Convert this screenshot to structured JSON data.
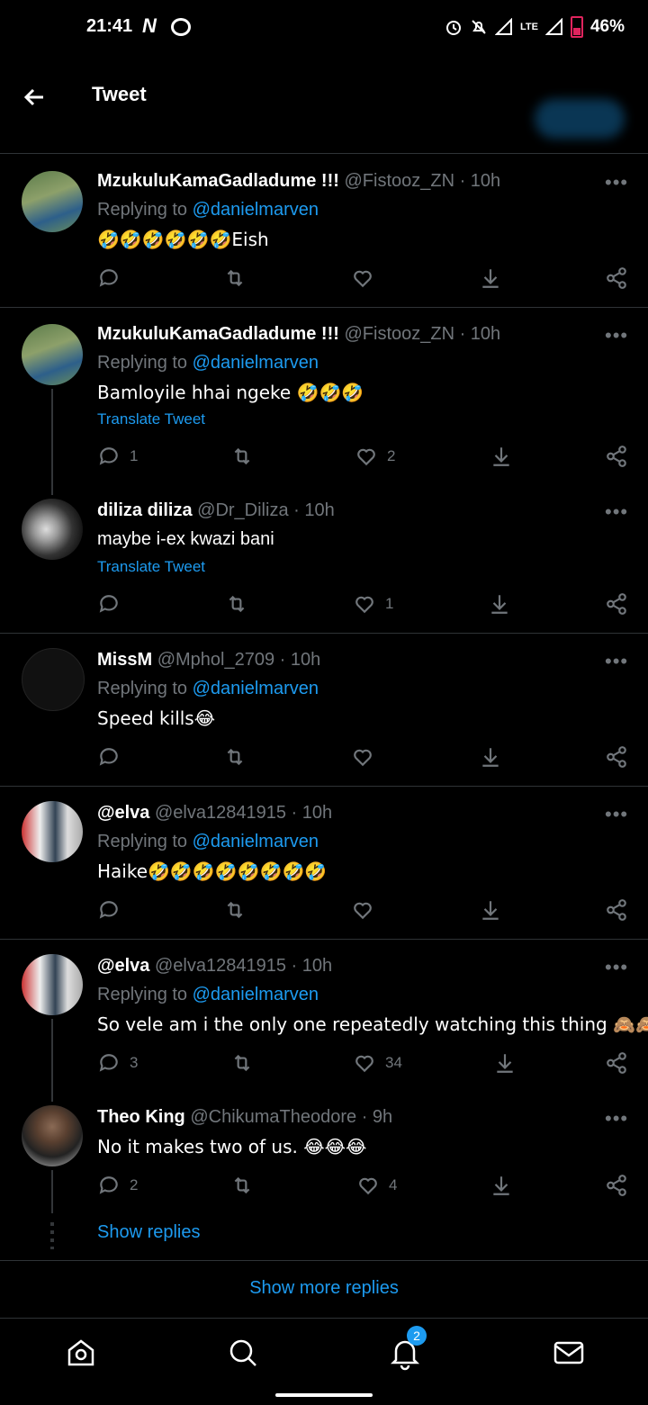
{
  "status_bar": {
    "time": "21:41",
    "n_icon": "N",
    "lte": "LTE",
    "battery": "46%"
  },
  "header": {
    "title": "Tweet"
  },
  "tweets": [
    {
      "name": "MzukuluKamaGadladume !!!",
      "handle": "@Fistooz_ZN · 10h",
      "replying_prefix": "Replying to ",
      "replying_to": "@danielmarven",
      "text": "🤣🤣🤣🤣🤣🤣Eish",
      "replies": "",
      "likes": ""
    },
    {
      "name": "MzukuluKamaGadladume !!!",
      "handle": "@Fistooz_ZN · 10h",
      "replying_prefix": "Replying to ",
      "replying_to": "@danielmarven",
      "text": "Bamloyile hhai ngeke 🤣🤣🤣",
      "translate": "Translate Tweet",
      "replies": "1",
      "likes": "2"
    },
    {
      "name": "diliza diliza",
      "handle": "@Dr_Diliza · 10h",
      "text": "maybe i-ex kwazi bani",
      "translate": "Translate Tweet",
      "replies": "",
      "likes": "1"
    },
    {
      "name": "MissM",
      "handle": "@Mphol_2709 · 10h",
      "replying_prefix": "Replying to ",
      "replying_to": "@danielmarven",
      "text": "Speed kills😂",
      "replies": "",
      "likes": ""
    },
    {
      "name": "@elva",
      "handle": "@elva12841915 · 10h",
      "replying_prefix": "Replying to ",
      "replying_to": "@danielmarven",
      "text": "Haike🤣🤣🤣🤣🤣🤣🤣🤣",
      "replies": "",
      "likes": ""
    },
    {
      "name": "@elva",
      "handle": "@elva12841915 · 10h",
      "replying_prefix": "Replying to ",
      "replying_to": "@danielmarven",
      "text": "So vele am i the only one repeatedly watching this thing 🙈🙈",
      "replies": "3",
      "likes": "34"
    },
    {
      "name": "Theo King",
      "handle": "@ChikumaTheodore · 9h",
      "text": "No it makes two of us. 😂😂😂",
      "replies": "2",
      "likes": "4"
    }
  ],
  "show_replies": "Show replies",
  "show_more_replies": "Show more replies",
  "bottom_nav": {
    "notifications_badge": "2"
  },
  "icons": [
    "back-arrow-icon",
    "more-options-icon",
    "reply-icon",
    "retweet-icon",
    "like-icon",
    "share-icon",
    "share-via-icon",
    "home-icon",
    "search-icon",
    "notifications-icon",
    "messages-icon"
  ],
  "colors": {
    "background": "#000000",
    "accent": "#1d9bf0",
    "muted": "#71767b",
    "divider": "#2f3336"
  }
}
